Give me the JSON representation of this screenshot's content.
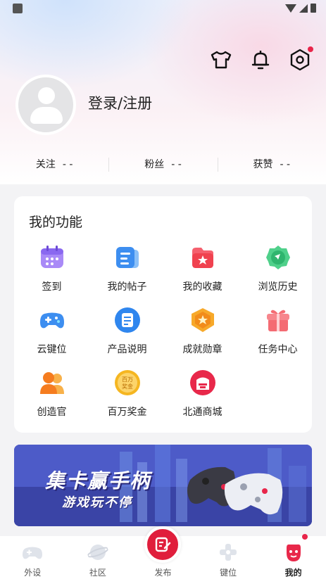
{
  "profile": {
    "login_label": "登录/注册"
  },
  "stats": [
    {
      "label": "关注",
      "value": "- -"
    },
    {
      "label": "粉丝",
      "value": "- -"
    },
    {
      "label": "获赞",
      "value": "- -"
    }
  ],
  "functions": {
    "title": "我的功能",
    "items": [
      {
        "label": "签到",
        "icon": "calendar-icon"
      },
      {
        "label": "我的帖子",
        "icon": "post-icon"
      },
      {
        "label": "我的收藏",
        "icon": "favorite-folder-icon"
      },
      {
        "label": "浏览历史",
        "icon": "history-icon"
      },
      {
        "label": "云键位",
        "icon": "gamepad-icon"
      },
      {
        "label": "产品说明",
        "icon": "manual-icon"
      },
      {
        "label": "成就勋章",
        "icon": "medal-icon"
      },
      {
        "label": "任务中心",
        "icon": "gift-icon"
      },
      {
        "label": "创造官",
        "icon": "creator-icon"
      },
      {
        "label": "百万奖金",
        "icon": "coin-icon"
      },
      {
        "label": "北通商城",
        "icon": "shop-icon"
      }
    ]
  },
  "banner": {
    "title": "集卡赢手柄",
    "subtitle": "游戏玩不停"
  },
  "tabbar": [
    {
      "label": "外设",
      "icon": "peripheral-icon"
    },
    {
      "label": "社区",
      "icon": "community-icon"
    },
    {
      "label": "发布",
      "icon": "publish-icon"
    },
    {
      "label": "键位",
      "icon": "keymap-icon"
    },
    {
      "label": "我的",
      "icon": "profile-icon"
    }
  ],
  "colors": {
    "accent": "#e01e3c",
    "notification_dot": "#e8254a"
  }
}
